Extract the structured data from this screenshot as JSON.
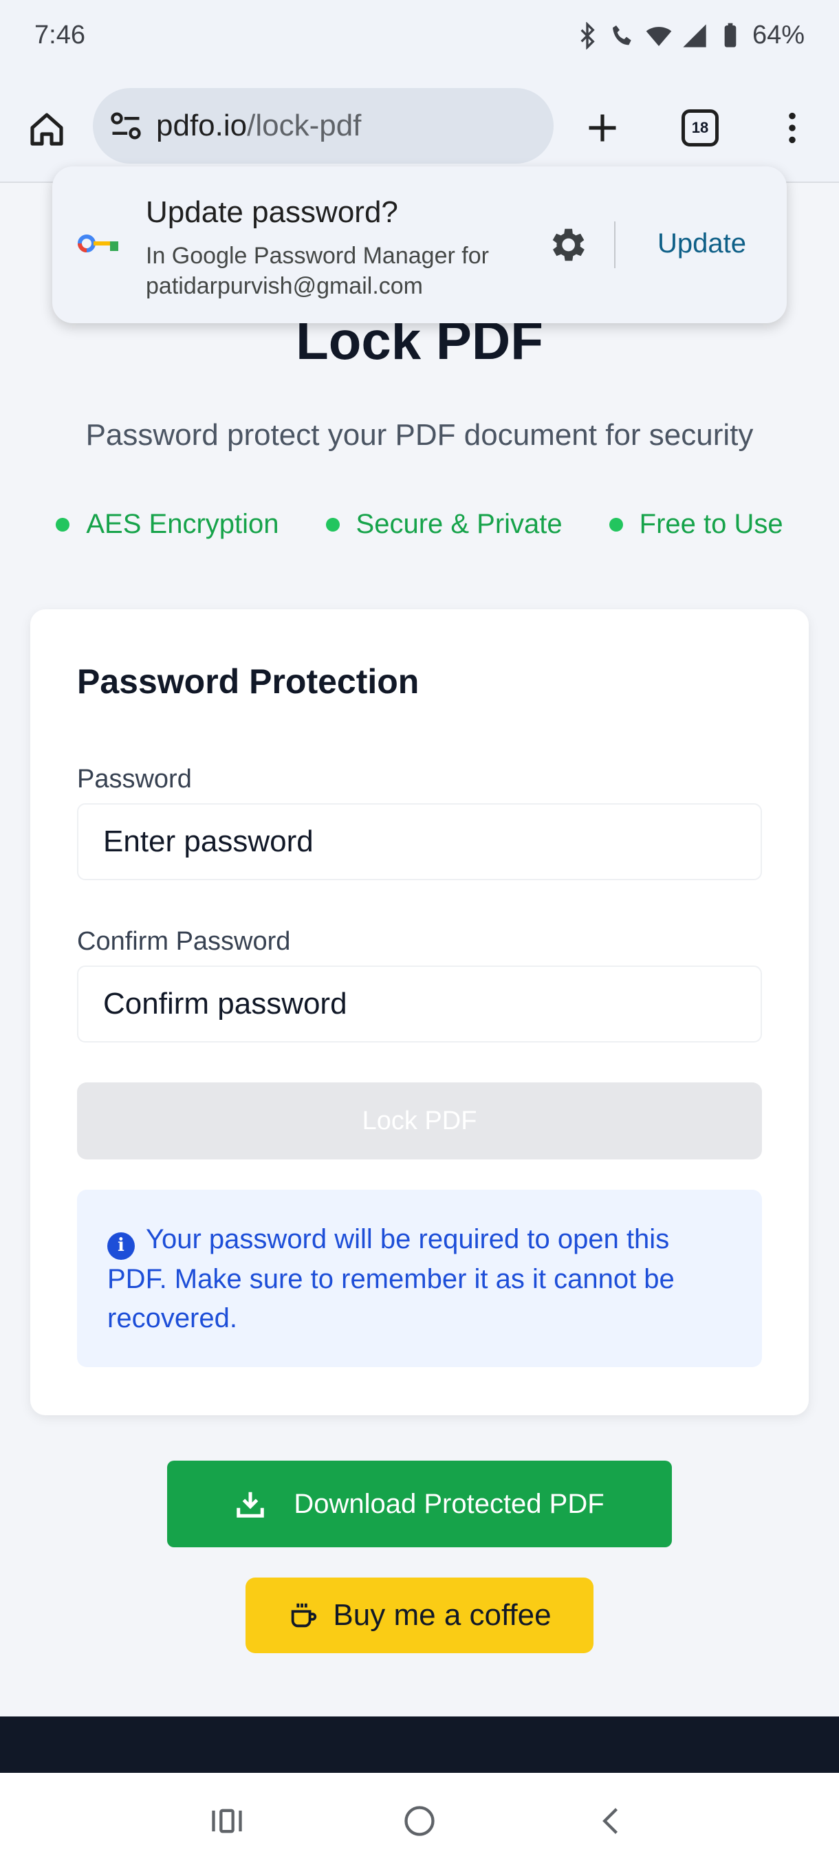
{
  "status_bar": {
    "time": "7:46",
    "battery": "64%",
    "icons": [
      "bluetooth-icon",
      "wifi-call-icon",
      "wifi-icon",
      "signal-icon",
      "battery-icon"
    ]
  },
  "browser": {
    "url_host": "pdfo.io",
    "url_path": "/lock-pdf",
    "tab_count": "18"
  },
  "password_popup": {
    "title": "Update password?",
    "subtitle_line1": "In Google Password Manager for",
    "subtitle_line2": "patidarpurvish@gmail.com",
    "update_label": "Update"
  },
  "page": {
    "title": "Lock PDF",
    "subtitle": "Password protect your PDF document for security",
    "features": [
      "AES Encryption",
      "Secure & Private",
      "Free to Use"
    ]
  },
  "form": {
    "title": "Password Protection",
    "password_label": "Password",
    "password_placeholder": "Enter password",
    "confirm_label": "Confirm Password",
    "confirm_placeholder": "Confirm password",
    "lock_button": "Lock PDF",
    "info_text": "Your password will be required to open this PDF. Make sure to remember it as it cannot be recovered."
  },
  "actions": {
    "download_label": "Download Protected PDF",
    "coffee_label": "Buy me a coffee"
  },
  "colors": {
    "accent_green": "#16a34a",
    "coffee_yellow": "#facc15",
    "info_blue": "#1d4ed8",
    "footer_dark": "#111827"
  }
}
